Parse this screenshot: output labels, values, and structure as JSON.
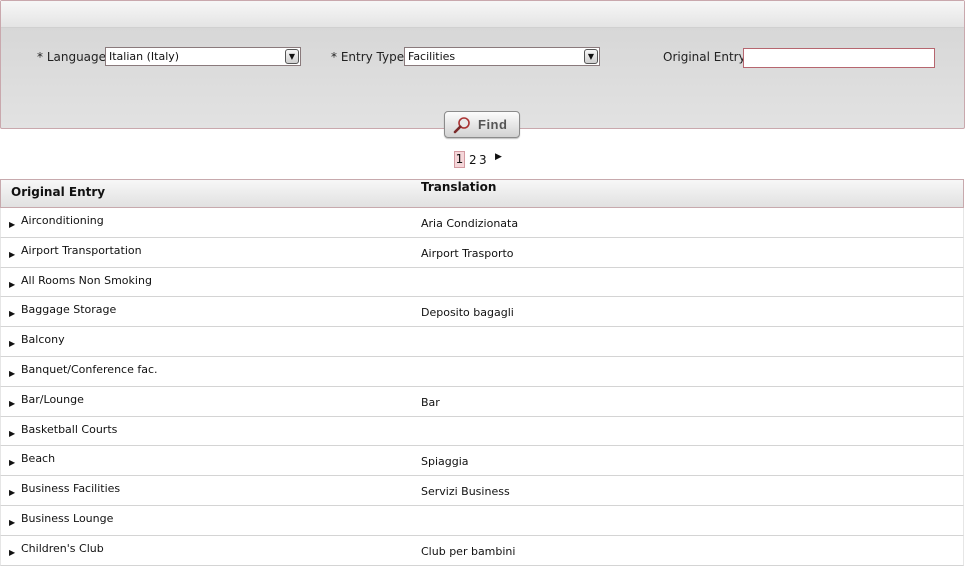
{
  "search": {
    "language_label": "* Language:",
    "language_value": "Italian (Italy)",
    "entry_type_label": "* Entry Type:",
    "entry_type_value": "Facilities",
    "original_entry_label": "Original Entry:",
    "original_entry_value": "",
    "find_label": "Find"
  },
  "pagination": {
    "current": "1",
    "pages": [
      "2",
      "3"
    ],
    "next_glyph": "▶"
  },
  "table": {
    "headers": {
      "original": "Original Entry",
      "translation": "Translation"
    },
    "rows": [
      {
        "original": "Airconditioning",
        "translation": "Aria Condizionata"
      },
      {
        "original": "Airport Transportation",
        "translation": "Airport Trasporto"
      },
      {
        "original": "All Rooms Non Smoking",
        "translation": ""
      },
      {
        "original": "Baggage Storage",
        "translation": "Deposito bagagli"
      },
      {
        "original": "Balcony",
        "translation": ""
      },
      {
        "original": "Banquet/Conference fac.",
        "translation": ""
      },
      {
        "original": "Bar/Lounge",
        "translation": "Bar"
      },
      {
        "original": "Basketball Courts",
        "translation": ""
      },
      {
        "original": "Beach",
        "translation": "Spiaggia"
      },
      {
        "original": "Business Facilities",
        "translation": "Servizi Business"
      },
      {
        "original": "Business Lounge",
        "translation": ""
      },
      {
        "original": "Children's Club",
        "translation": "Club per bambini"
      }
    ]
  },
  "icons": {
    "expand": "triangle-right-icon",
    "find": "magnifier-icon",
    "dropdown": "dropdown-arrow-icon"
  },
  "colors": {
    "accent_border": "#c9a8ad",
    "current_page_bg": "#f5d6d9"
  }
}
